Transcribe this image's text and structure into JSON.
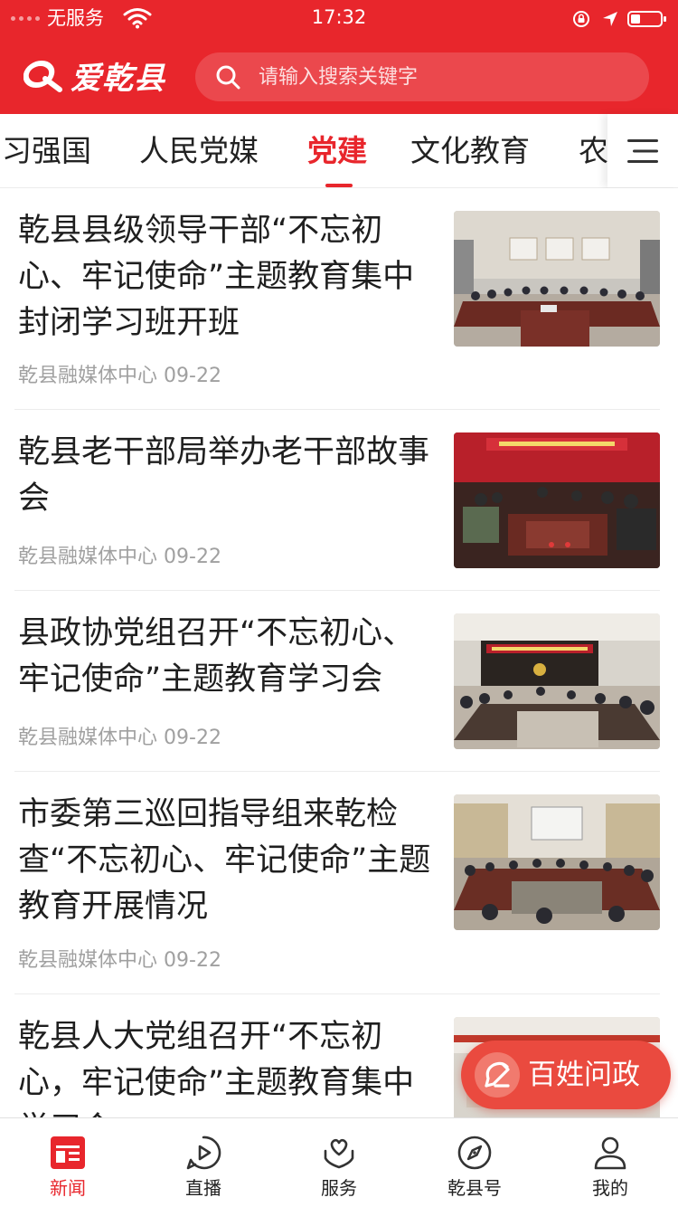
{
  "status_bar": {
    "carrier": "无服务",
    "time": "17:32"
  },
  "header": {
    "logo_text": "爱乾县",
    "search_placeholder": "请输入搜索关键字"
  },
  "tabs": [
    {
      "label": "习强国",
      "active": false
    },
    {
      "label": "人民党媒",
      "active": false
    },
    {
      "label": "党建",
      "active": true
    },
    {
      "label": "文化教育",
      "active": false
    },
    {
      "label": "农",
      "active": false
    }
  ],
  "news": [
    {
      "title": "乾县县级领导干部“不忘初心、牢记使命”主题教育集中封闭学习班开班",
      "source": "乾县融媒体中心",
      "date": "09-22"
    },
    {
      "title": "乾县老干部局举办老干部故事会",
      "source": "乾县融媒体中心",
      "date": "09-22"
    },
    {
      "title": "县政协党组召开“不忘初心、牢记使命”主题教育学习会",
      "source": "乾县融媒体中心",
      "date": "09-22"
    },
    {
      "title": "市委第三巡回指导组来乾检查“不忘初心、牢记使命”主题教育开展情况",
      "source": "乾县融媒体中心",
      "date": "09-22"
    },
    {
      "title": "乾县人大党组召开“不忘初心，牢记使命”主题教育集中学习会",
      "source": "",
      "date": ""
    }
  ],
  "float_button": {
    "label": "百姓问政"
  },
  "bottom_nav": [
    {
      "label": "新闻",
      "icon": "news-icon",
      "active": true
    },
    {
      "label": "直播",
      "icon": "play-icon",
      "active": false
    },
    {
      "label": "服务",
      "icon": "service-icon",
      "active": false
    },
    {
      "label": "乾县号",
      "icon": "compass-icon",
      "active": false
    },
    {
      "label": "我的",
      "icon": "user-icon",
      "active": false
    }
  ],
  "colors": {
    "brand": "#e8262c",
    "float_button": "#ea4a3f",
    "meta_text": "#a0a0a0"
  }
}
